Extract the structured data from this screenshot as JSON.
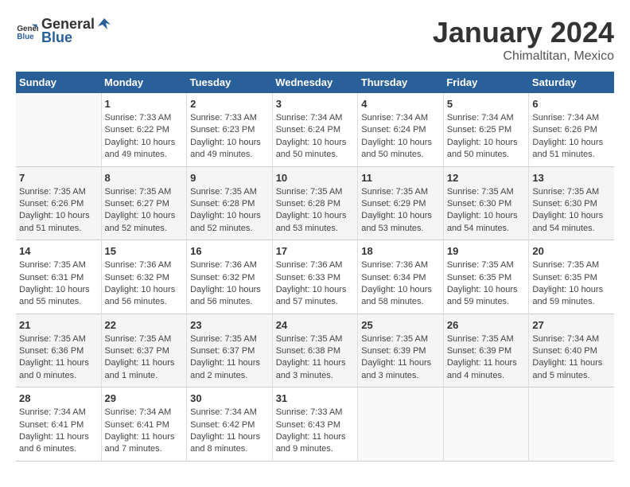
{
  "header": {
    "logo_general": "General",
    "logo_blue": "Blue",
    "month_title": "January 2024",
    "location": "Chimaltitan, Mexico"
  },
  "days_of_week": [
    "Sunday",
    "Monday",
    "Tuesday",
    "Wednesday",
    "Thursday",
    "Friday",
    "Saturday"
  ],
  "weeks": [
    [
      {
        "day": "",
        "info": ""
      },
      {
        "day": "1",
        "info": "Sunrise: 7:33 AM\nSunset: 6:22 PM\nDaylight: 10 hours\nand 49 minutes."
      },
      {
        "day": "2",
        "info": "Sunrise: 7:33 AM\nSunset: 6:23 PM\nDaylight: 10 hours\nand 49 minutes."
      },
      {
        "day": "3",
        "info": "Sunrise: 7:34 AM\nSunset: 6:24 PM\nDaylight: 10 hours\nand 50 minutes."
      },
      {
        "day": "4",
        "info": "Sunrise: 7:34 AM\nSunset: 6:24 PM\nDaylight: 10 hours\nand 50 minutes."
      },
      {
        "day": "5",
        "info": "Sunrise: 7:34 AM\nSunset: 6:25 PM\nDaylight: 10 hours\nand 50 minutes."
      },
      {
        "day": "6",
        "info": "Sunrise: 7:34 AM\nSunset: 6:26 PM\nDaylight: 10 hours\nand 51 minutes."
      }
    ],
    [
      {
        "day": "7",
        "info": "Sunrise: 7:35 AM\nSunset: 6:26 PM\nDaylight: 10 hours\nand 51 minutes."
      },
      {
        "day": "8",
        "info": "Sunrise: 7:35 AM\nSunset: 6:27 PM\nDaylight: 10 hours\nand 52 minutes."
      },
      {
        "day": "9",
        "info": "Sunrise: 7:35 AM\nSunset: 6:28 PM\nDaylight: 10 hours\nand 52 minutes."
      },
      {
        "day": "10",
        "info": "Sunrise: 7:35 AM\nSunset: 6:28 PM\nDaylight: 10 hours\nand 53 minutes."
      },
      {
        "day": "11",
        "info": "Sunrise: 7:35 AM\nSunset: 6:29 PM\nDaylight: 10 hours\nand 53 minutes."
      },
      {
        "day": "12",
        "info": "Sunrise: 7:35 AM\nSunset: 6:30 PM\nDaylight: 10 hours\nand 54 minutes."
      },
      {
        "day": "13",
        "info": "Sunrise: 7:35 AM\nSunset: 6:30 PM\nDaylight: 10 hours\nand 54 minutes."
      }
    ],
    [
      {
        "day": "14",
        "info": "Sunrise: 7:35 AM\nSunset: 6:31 PM\nDaylight: 10 hours\nand 55 minutes."
      },
      {
        "day": "15",
        "info": "Sunrise: 7:36 AM\nSunset: 6:32 PM\nDaylight: 10 hours\nand 56 minutes."
      },
      {
        "day": "16",
        "info": "Sunrise: 7:36 AM\nSunset: 6:32 PM\nDaylight: 10 hours\nand 56 minutes."
      },
      {
        "day": "17",
        "info": "Sunrise: 7:36 AM\nSunset: 6:33 PM\nDaylight: 10 hours\nand 57 minutes."
      },
      {
        "day": "18",
        "info": "Sunrise: 7:36 AM\nSunset: 6:34 PM\nDaylight: 10 hours\nand 58 minutes."
      },
      {
        "day": "19",
        "info": "Sunrise: 7:35 AM\nSunset: 6:35 PM\nDaylight: 10 hours\nand 59 minutes."
      },
      {
        "day": "20",
        "info": "Sunrise: 7:35 AM\nSunset: 6:35 PM\nDaylight: 10 hours\nand 59 minutes."
      }
    ],
    [
      {
        "day": "21",
        "info": "Sunrise: 7:35 AM\nSunset: 6:36 PM\nDaylight: 11 hours\nand 0 minutes."
      },
      {
        "day": "22",
        "info": "Sunrise: 7:35 AM\nSunset: 6:37 PM\nDaylight: 11 hours\nand 1 minute."
      },
      {
        "day": "23",
        "info": "Sunrise: 7:35 AM\nSunset: 6:37 PM\nDaylight: 11 hours\nand 2 minutes."
      },
      {
        "day": "24",
        "info": "Sunrise: 7:35 AM\nSunset: 6:38 PM\nDaylight: 11 hours\nand 3 minutes."
      },
      {
        "day": "25",
        "info": "Sunrise: 7:35 AM\nSunset: 6:39 PM\nDaylight: 11 hours\nand 3 minutes."
      },
      {
        "day": "26",
        "info": "Sunrise: 7:35 AM\nSunset: 6:39 PM\nDaylight: 11 hours\nand 4 minutes."
      },
      {
        "day": "27",
        "info": "Sunrise: 7:34 AM\nSunset: 6:40 PM\nDaylight: 11 hours\nand 5 minutes."
      }
    ],
    [
      {
        "day": "28",
        "info": "Sunrise: 7:34 AM\nSunset: 6:41 PM\nDaylight: 11 hours\nand 6 minutes."
      },
      {
        "day": "29",
        "info": "Sunrise: 7:34 AM\nSunset: 6:41 PM\nDaylight: 11 hours\nand 7 minutes."
      },
      {
        "day": "30",
        "info": "Sunrise: 7:34 AM\nSunset: 6:42 PM\nDaylight: 11 hours\nand 8 minutes."
      },
      {
        "day": "31",
        "info": "Sunrise: 7:33 AM\nSunset: 6:43 PM\nDaylight: 11 hours\nand 9 minutes."
      },
      {
        "day": "",
        "info": ""
      },
      {
        "day": "",
        "info": ""
      },
      {
        "day": "",
        "info": ""
      }
    ]
  ]
}
